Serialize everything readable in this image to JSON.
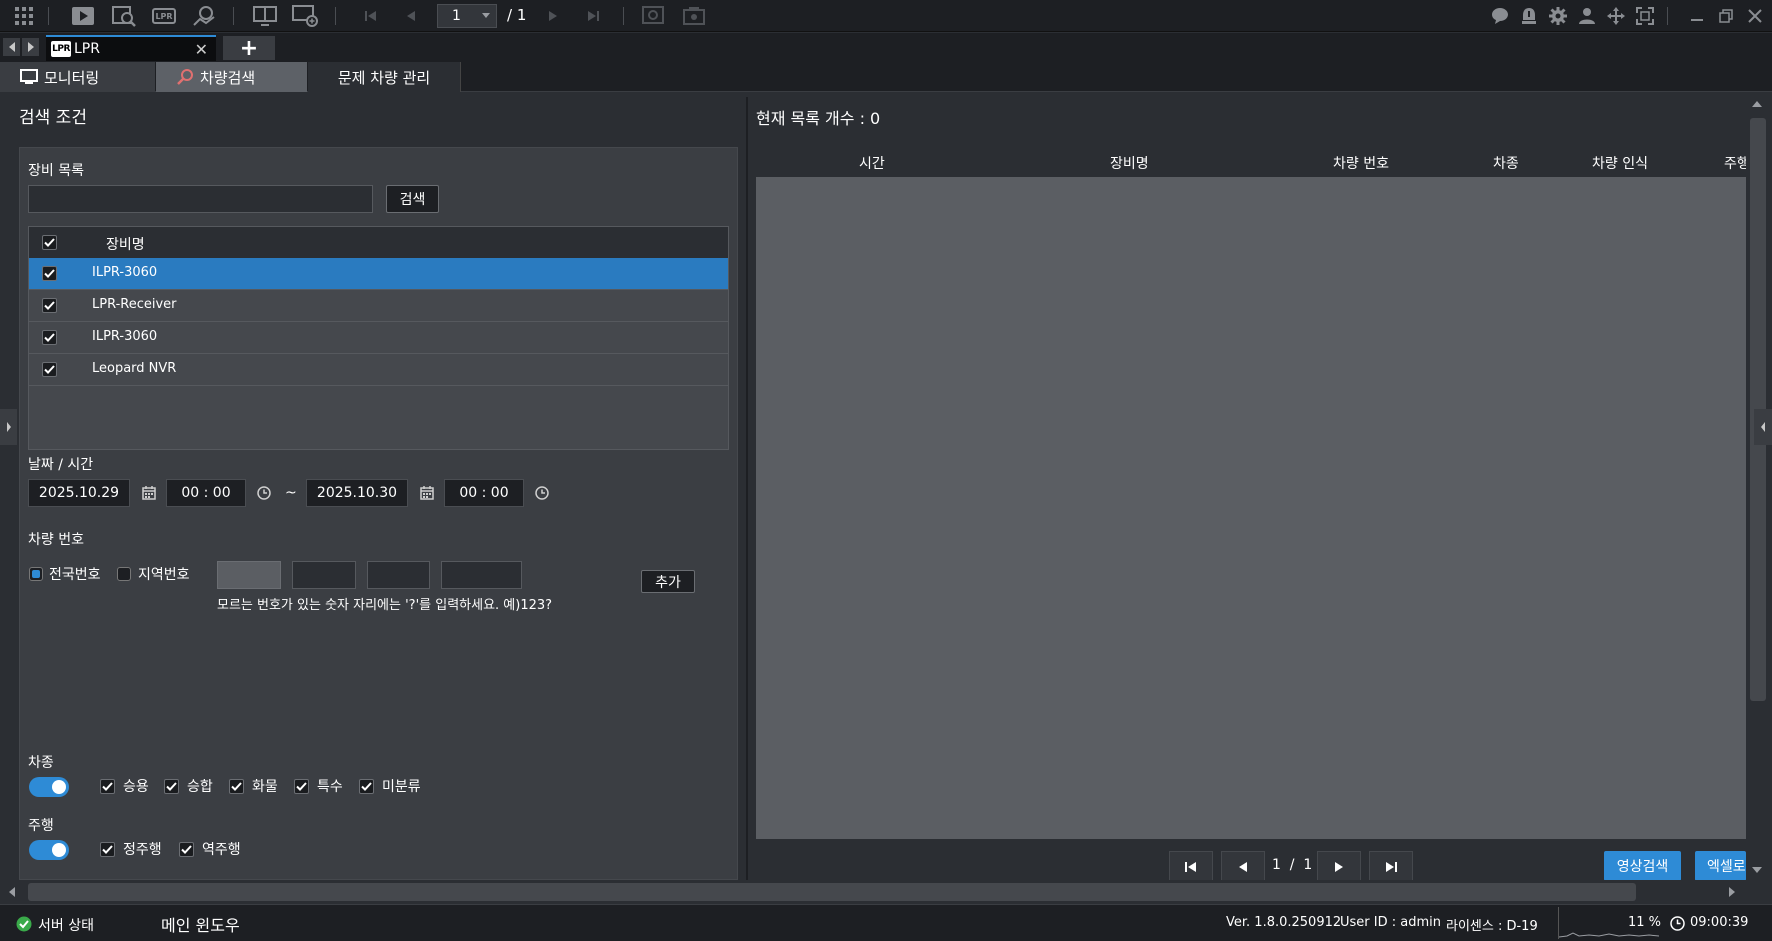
{
  "toolbar": {
    "icons": [
      "grid-icon",
      "play-icon",
      "search-video-icon",
      "lpr-icon",
      "map-icon",
      "layout-icon",
      "add-layout-icon",
      "first-page-icon",
      "prev-page-icon",
      "next-page-icon",
      "last-page-icon",
      "refresh-icon",
      "camera-icon",
      "chat-icon",
      "alarm-icon",
      "settings-icon",
      "user-icon",
      "move-icon",
      "fullscreen-icon",
      "minimize-icon",
      "restore-icon",
      "close-icon"
    ],
    "lpr_icon_text": "LPR",
    "page_current": "1",
    "page_total": "/ 1"
  },
  "tabs": {
    "logo_text": "LPR",
    "active_label": "LPR",
    "add_label": "+"
  },
  "menu": {
    "monitor": "모니터링",
    "search": "차량검색",
    "problem": "문제 차량 관리"
  },
  "left": {
    "title": "검색 조건",
    "device_list_label": "장비 목록",
    "search_button": "검색",
    "device_header": "장비명",
    "devices": [
      {
        "name": "ILPR-3060",
        "checked": true,
        "selected": true
      },
      {
        "name": "LPR-Receiver",
        "checked": true,
        "selected": false
      },
      {
        "name": "ILPR-3060",
        "checked": true,
        "selected": false
      },
      {
        "name": "Leopard NVR",
        "checked": true,
        "selected": false
      }
    ],
    "datetime_label": "날짜 / 시간",
    "start_date": "2025.10.29",
    "start_time": "00 : 00",
    "tilde": "~",
    "end_date": "2025.10.30",
    "end_time": "00 : 00",
    "plate_label": "차량 번호",
    "plate_national": "전국번호",
    "plate_regional": "지역번호",
    "add_button": "추가",
    "plate_hint": "모르는 번호가 있는 숫자 자리에는 '?'를 입력하세요. 예)123?",
    "vehicle_type_label": "차종",
    "vehicle_types": [
      "승용",
      "승합",
      "화물",
      "특수",
      "미분류"
    ],
    "direction_label": "주행",
    "directions": [
      "정주행",
      "역주행"
    ]
  },
  "right": {
    "title": "현재 목록 개수 : 0",
    "columns": [
      "시간",
      "장비명",
      "차량 번호",
      "차종",
      "차량 인식",
      "주행"
    ],
    "pager_text": "1  /  1",
    "video_search_button": "영상검색",
    "excel_button": "엑셀로"
  },
  "status": {
    "server_status": "서버 상태",
    "main_window": "메인 윈도우",
    "version": "Ver. 1.8.0.250912",
    "user_id": "User ID : admin",
    "license": "라이센스 : D-19",
    "cpu": "11 %",
    "clock": "09:00:39"
  },
  "colors": {
    "accent": "#2e8bd6",
    "selected_row": "#2a7bc0",
    "background": "#2b2e33"
  }
}
